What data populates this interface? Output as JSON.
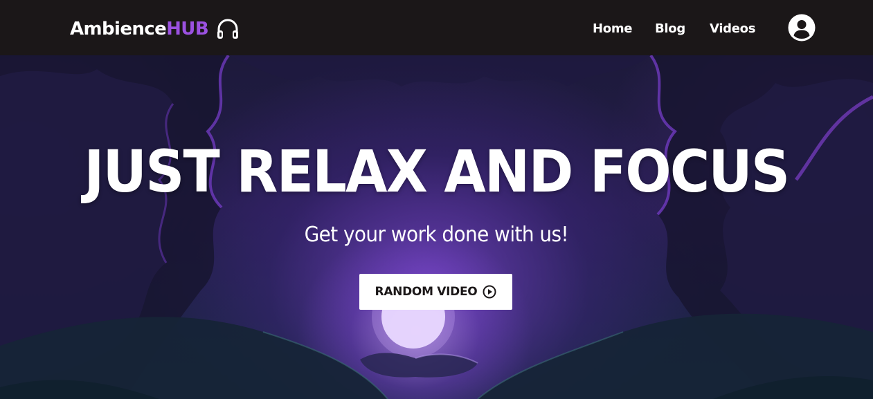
{
  "nav": {
    "logo_main": "Ambience",
    "logo_accent": "HUB",
    "logo_icon": "headphones-icon",
    "links": [
      {
        "label": "Home"
      },
      {
        "label": "Blog"
      },
      {
        "label": "Videos"
      }
    ],
    "account_icon": "user-account-icon"
  },
  "hero": {
    "title": "JUST RELAX AND FOCUS",
    "subtitle": "Get your work done with us!",
    "button_label": "RANDOM VIDEO",
    "button_icon": "play-circle-icon"
  },
  "colors": {
    "navbar_bg": "#1b1718",
    "accent": "#9b51e0",
    "text": "#ffffff",
    "button_bg": "#ffffff",
    "button_text": "#1b1718"
  }
}
